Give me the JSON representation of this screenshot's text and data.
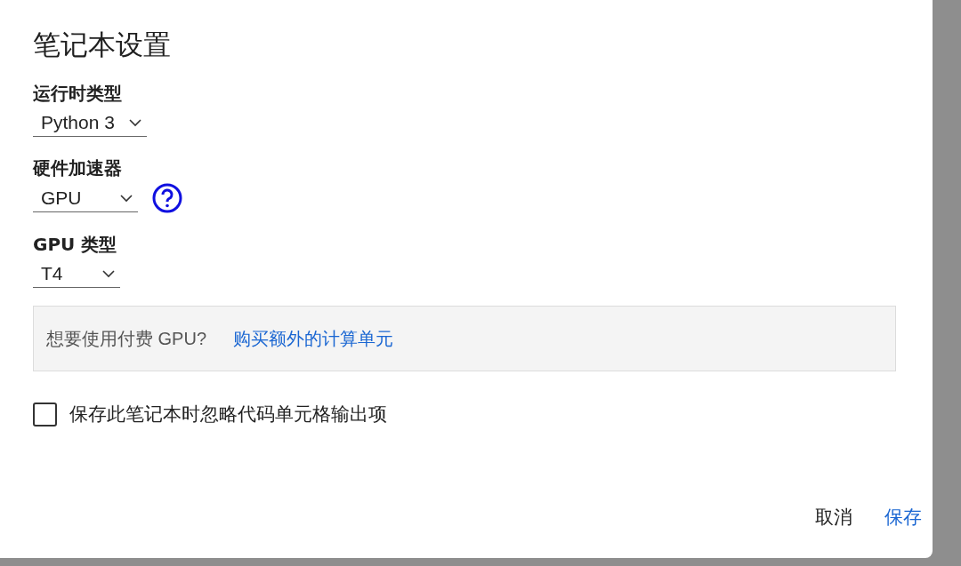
{
  "dialog": {
    "title": "笔记本设置",
    "fields": [
      {
        "label": "运行时类型",
        "value": "Python 3",
        "help": false
      },
      {
        "label": "硬件加速器",
        "value": "GPU",
        "help": true
      },
      {
        "label": "GPU 类型",
        "value": "T4",
        "help": false
      }
    ],
    "notice": {
      "text": "想要使用付费 GPU?",
      "link": "购买额外的计算单元"
    },
    "checkbox": {
      "label": "保存此笔记本时忽略代码单元格输出项",
      "checked": false
    },
    "buttons": [
      {
        "label": "取消",
        "kind": "plain"
      },
      {
        "label": "保存",
        "kind": "primary"
      }
    ]
  }
}
